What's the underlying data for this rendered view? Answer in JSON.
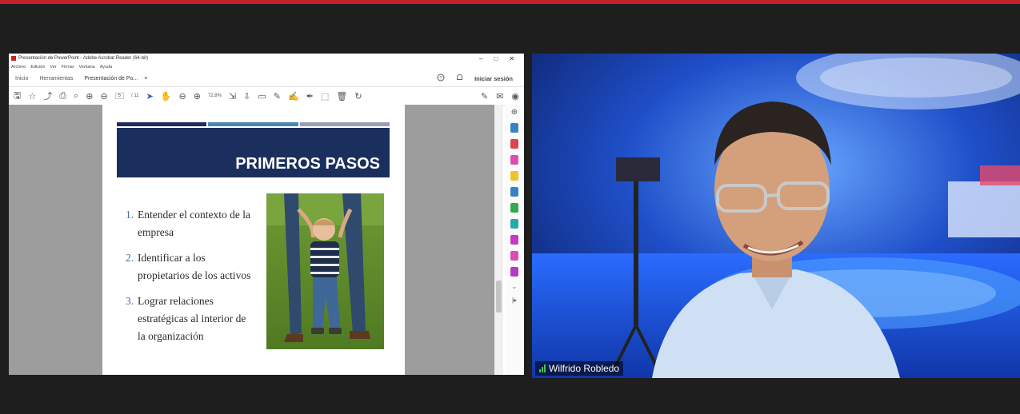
{
  "colors": {
    "brand_red": "#c8202a",
    "slide_banner": "#1b2f5e",
    "stripe1": "#1b2f5e",
    "stripe2": "#4b86b4",
    "stripe3": "#9aa0b4"
  },
  "acrobat": {
    "window_title": "Presentación de PowerPoint - Adobe Acrobat Reader (64-bit)",
    "win_controls": [
      "–",
      "□",
      "✕"
    ],
    "menus": [
      "Archivo",
      "Edición",
      "Ver",
      "Firmar",
      "Ventana",
      "Ayuda"
    ],
    "tabs": {
      "home": "Inicio",
      "tools": "Herramientas",
      "doc": "Presentación de Po...",
      "close": "×"
    },
    "help_icon": "?",
    "bell_icon": "🔔",
    "signin": "Iniciar sesión",
    "page_current": "5",
    "page_total": "/ 11",
    "zoom": "72,8%"
  },
  "slide": {
    "title": "PRIMEROS PASOS",
    "items": [
      {
        "num": "1.",
        "text": "Entender el contexto de la empresa"
      },
      {
        "num": "2.",
        "text": "Identificar a los propietarios de los activos"
      },
      {
        "num": "3.",
        "text": "Lograr relaciones estratégicas al interior de la organización"
      }
    ]
  },
  "participant": {
    "name": "Wilfrido Robledo"
  }
}
